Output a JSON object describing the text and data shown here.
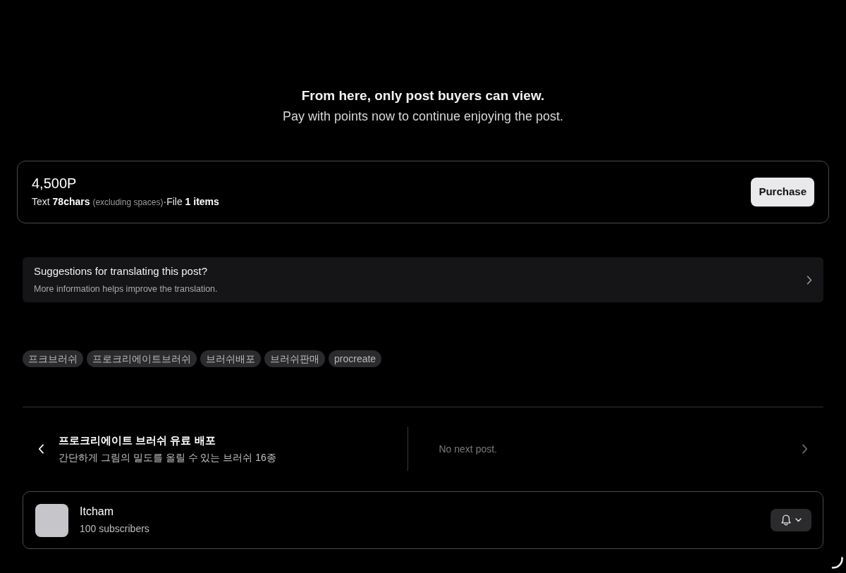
{
  "paywall": {
    "title": "From here, only post buyers can view.",
    "subtitle": "Pay with points now to continue enjoying the post."
  },
  "purchase_card": {
    "price": "4,500P",
    "details": [
      {
        "kind": "text",
        "text": "Text **78chars** "
      },
      {
        "kind": "note",
        "text": "(excluding spaces)"
      },
      {
        "kind": "text",
        "text": "·File **1 items**"
      }
    ],
    "button": "Purchase"
  },
  "translation_suggestion": {
    "title": "Suggestions for translating this post?",
    "subtitle": "More information helps improve the translation."
  },
  "tags": [
    "프크브러쉬",
    "프로크리에이트브러쉬",
    "브러쉬배포",
    "브러쉬판매",
    "procreate"
  ],
  "navigation": [
    {
      "kind": "previous",
      "title": "프로크리에이트 브러쉬 유료 배포",
      "excerpt": "간단하게 그림의 밀도를 올릴 수 있는 브러쉬 16종",
      "disabled": false
    },
    {
      "kind": "next",
      "message": "No next post.",
      "disabled": true
    }
  ],
  "creator": {
    "name": "Itcham",
    "subscribers": "100 subscribers"
  }
}
